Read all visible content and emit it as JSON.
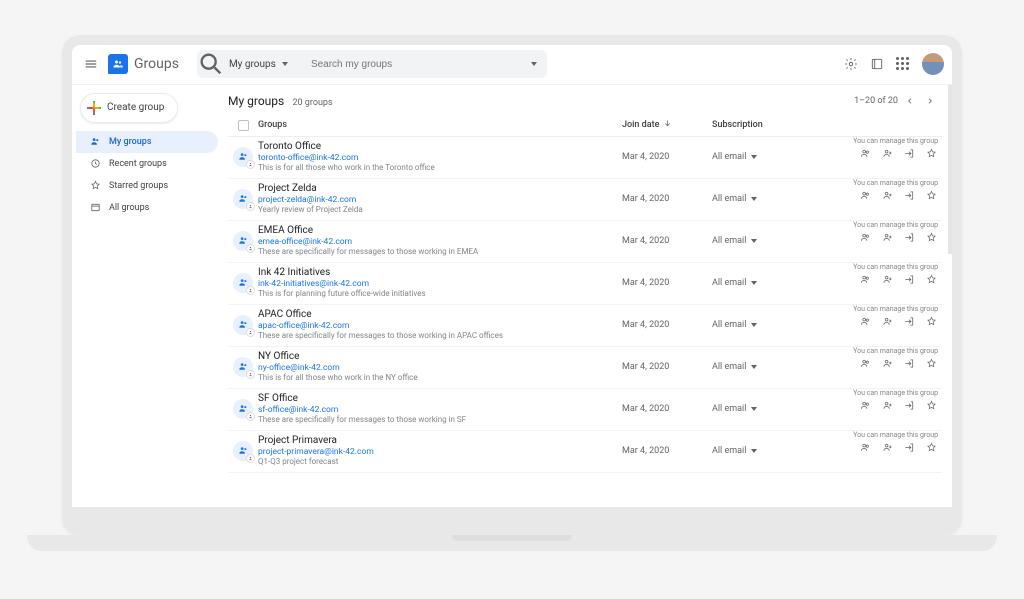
{
  "brand": "Groups",
  "search": {
    "filter": "My groups",
    "placeholder": "Search my groups"
  },
  "sidebar": {
    "create": "Create group",
    "items": [
      {
        "label": "My groups"
      },
      {
        "label": "Recent groups"
      },
      {
        "label": "Starred groups"
      },
      {
        "label": "All groups"
      }
    ]
  },
  "page": {
    "title": "My groups",
    "subtitle": "20 groups",
    "pager": "1–20 of 20"
  },
  "columns": {
    "groups": "Groups",
    "join_date": "Join date",
    "subscription": "Subscription"
  },
  "manage_text": "You can manage this group",
  "groups": [
    {
      "name": "Toronto Office",
      "email": "toronto-office@ink-42.com",
      "desc": "This is for all those who work in the Toronto office",
      "join_date": "Mar 4, 2020",
      "subscription": "All email"
    },
    {
      "name": "Project Zelda",
      "email": "project-zelda@ink-42.com",
      "desc": "Yearly review of Project Zelda",
      "join_date": "Mar 4, 2020",
      "subscription": "All email"
    },
    {
      "name": "EMEA Office",
      "email": "emea-office@ink-42.com",
      "desc": "These are specifically for messages to those working in EMEA",
      "join_date": "Mar 4, 2020",
      "subscription": "All email"
    },
    {
      "name": "Ink 42 Initiatives",
      "email": "ink-42-initiatives@ink-42.com",
      "desc": "This is for planning future office-wide initiatives",
      "join_date": "Mar 4, 2020",
      "subscription": "All email"
    },
    {
      "name": "APAC Office",
      "email": "apac-office@ink-42.com",
      "desc": "These are specifically for messages to those working in APAC offices",
      "join_date": "Mar 4, 2020",
      "subscription": "All email"
    },
    {
      "name": "NY Office",
      "email": "ny-office@ink-42.com",
      "desc": "This is for all those who work in the NY office",
      "join_date": "Mar 4, 2020",
      "subscription": "All email"
    },
    {
      "name": "SF Office",
      "email": "sf-office@ink-42.com",
      "desc": "These are specifically for messages to those working in SF",
      "join_date": "Mar 4, 2020",
      "subscription": "All email"
    },
    {
      "name": "Project Primavera",
      "email": "project-primavera@ink-42.com",
      "desc": "Q1-Q3 project forecast",
      "join_date": "Mar 4, 2020",
      "subscription": "All email"
    }
  ]
}
